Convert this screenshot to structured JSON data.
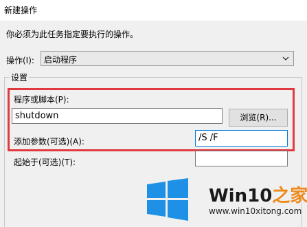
{
  "window": {
    "title": "新建操作"
  },
  "description": "你必须为此任务指定要执行的操作。",
  "action": {
    "label": "操作(I):",
    "selected": "启动程序"
  },
  "settings": {
    "label": "设置",
    "program_label": "程序或脚本(P):",
    "program_value": "shutdown",
    "browse_label": "浏览(R)...",
    "args_label": "添加参数(可选)(A):",
    "args_value": "/S /F",
    "startin_label": "起始于(可选)(T):",
    "startin_value": ""
  },
  "watermark": {
    "brand_main": "Win10",
    "brand_suffix": "之家",
    "url": "www.win10xitong.com"
  },
  "colors": {
    "highlight_border": "#e0393f",
    "logo_blue": "#1e90e6",
    "brand_orange": "#ee8a1a"
  },
  "icons": {
    "dropdown": "chevron-down-icon",
    "logo": "windows-logo-icon"
  }
}
